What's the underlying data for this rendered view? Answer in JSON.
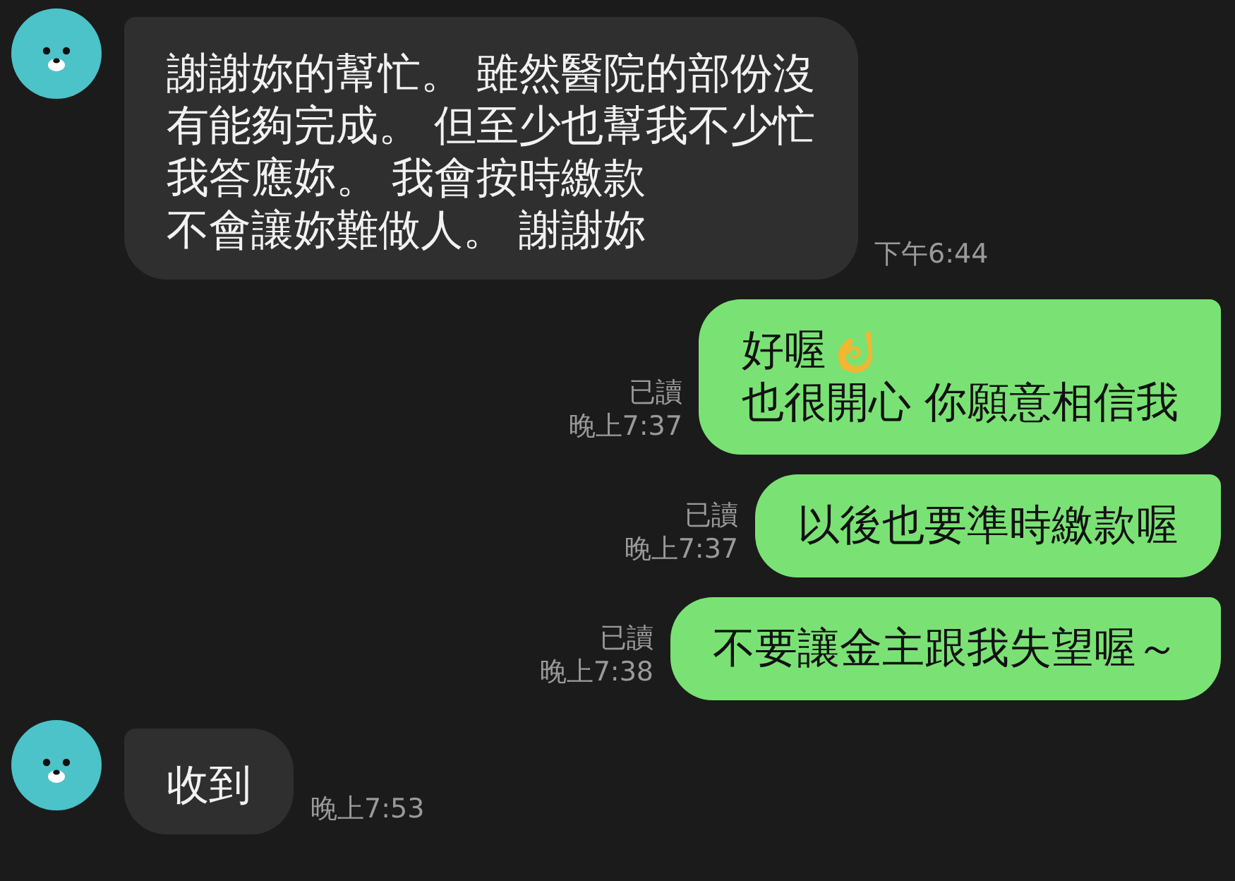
{
  "messages": [
    {
      "kind": "incoming",
      "lines": [
        {
          "text": "謝謝妳的幫忙。 雖然醫院的部份沒"
        },
        {
          "text": "有能夠完成。 但至少也幫我不少忙"
        },
        {
          "text": "我答應妳。 我會按時繳款"
        },
        {
          "text": "不會讓妳難做人。 謝謝妳"
        }
      ],
      "time": "下午6:44"
    },
    {
      "kind": "outgoing",
      "lines": [
        {
          "text": "好喔",
          "kind": "emoji"
        },
        {
          "text": "也很開心 你願意相信我"
        }
      ],
      "read": "已讀",
      "time": "晚上7:37"
    },
    {
      "kind": "outgoing",
      "lines": [
        {
          "text": "以後也要準時繳款喔"
        }
      ],
      "read": "已讀",
      "time": "晚上7:37"
    },
    {
      "kind": "outgoing",
      "lines": [
        {
          "text": "不要讓金主跟我失望喔～"
        }
      ],
      "read": "已讀",
      "time": "晚上7:38"
    },
    {
      "kind": "incoming",
      "lines": [
        {
          "text": "收到"
        }
      ],
      "time": "晚上7:53"
    }
  ]
}
